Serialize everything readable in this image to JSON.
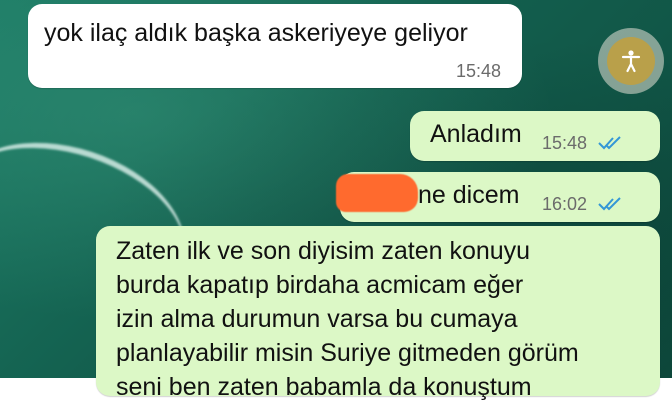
{
  "messages": [
    {
      "direction": "incoming",
      "text": "yok ilaç aldık başka askeriyeye geliyor",
      "time": "15:48"
    },
    {
      "direction": "outgoing",
      "text": "Anladım",
      "time": "15:48",
      "status": "read"
    },
    {
      "direction": "outgoing",
      "text": "ne dicem",
      "time": "16:02",
      "status": "read",
      "redacted_prefix": true
    },
    {
      "direction": "outgoing",
      "lines": [
        "Zaten ilk ve son diyisim zaten konuyu",
        "burda kapatıp birdaha acmicam eğer",
        "izin alma durumun varsa bu cumaya",
        "planlayabilir misin Suriye gitmeden görüm",
        "seni ben zaten babamla da konuştum"
      ]
    }
  ],
  "colors": {
    "incoming_bubble": "#ffffff",
    "outgoing_bubble": "#dcf8c6",
    "read_ticks": "#3497d6",
    "redaction": "#ff6a2e"
  },
  "icons": {
    "accessibility": "accessibility-person-icon",
    "read_receipt": "double-check-icon"
  }
}
